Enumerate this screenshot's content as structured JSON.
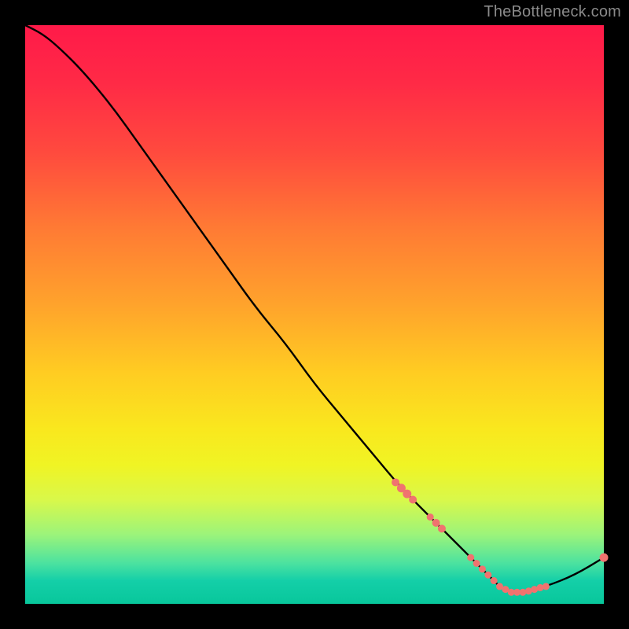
{
  "watermark": "TheBottleneck.com",
  "chart_data": {
    "type": "line",
    "title": "",
    "xlabel": "",
    "ylabel": "",
    "xlim": [
      0,
      100
    ],
    "ylim": [
      0,
      100
    ],
    "grid": false,
    "legend": false,
    "curve_note": "Bottleneck-vs-value style curve over a vertical rainbow gradient. Axes are unlabeled; y=0 at bottom (green), y=100 at top (red). Curve starts near top-left, descends diagonally, dips to a minimum around x≈83, then rises slightly at the right edge.",
    "series": [
      {
        "name": "curve",
        "x": [
          0,
          3,
          6,
          10,
          15,
          20,
          25,
          30,
          35,
          40,
          45,
          50,
          55,
          60,
          65,
          70,
          75,
          80,
          83,
          86,
          90,
          95,
          100
        ],
        "y": [
          100,
          98.5,
          96,
          92,
          86,
          79,
          72,
          65,
          58,
          51,
          45,
          38,
          32,
          26,
          20,
          15,
          10,
          5,
          2,
          2,
          3,
          5,
          8
        ]
      }
    ],
    "markers": {
      "name": "highlight-dots",
      "note": "Salmon-colored markers lying on the curve, clustered on the descending part (~x 65–72) and along the trough (~x 77–90), with one at the far right tip.",
      "x": [
        64,
        65,
        66,
        67,
        70,
        71,
        72,
        77,
        78,
        79,
        80,
        81,
        82,
        83,
        84,
        85,
        86,
        87,
        88,
        89,
        90,
        100
      ],
      "y": [
        21,
        20,
        19,
        18,
        15,
        14,
        13,
        8,
        7,
        6,
        5,
        4,
        3,
        2.5,
        2,
        2,
        2,
        2.2,
        2.5,
        2.8,
        3,
        8
      ],
      "r": [
        5,
        5.5,
        5.5,
        5,
        4.5,
        5,
        5,
        4.5,
        4.5,
        4.5,
        4.5,
        4.5,
        4.5,
        4.5,
        4.5,
        4.5,
        4.5,
        4.5,
        4.5,
        4.5,
        4.5,
        5.5
      ]
    },
    "colors": {
      "curve_stroke": "#000000",
      "marker_fill": "#f0736f",
      "gradient_top": "#ff1a49",
      "gradient_bottom": "#08c79b",
      "background": "#000000",
      "watermark": "#8a8a8a"
    }
  }
}
